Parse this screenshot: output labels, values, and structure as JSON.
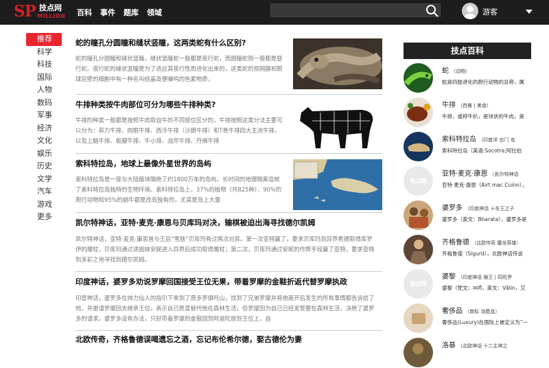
{
  "header": {
    "logo_sp": "SP",
    "logo_cn": "技点网",
    "logo_en": "MILLION",
    "nav": [
      "百科",
      "事件",
      "题库",
      "领域"
    ],
    "search_placeholder": "",
    "username": "游客"
  },
  "sidebar": {
    "items": [
      "推荐",
      "科学",
      "科技",
      "国际",
      "人物",
      "数码",
      "军事",
      "经济",
      "文化",
      "娱乐",
      "历史",
      "文学",
      "汽车",
      "游戏",
      "更多"
    ]
  },
  "articles": [
    {
      "title": "蛇的瞳孔分圆瞳和缝状竖瞳，这两类蛇有什么区别?",
      "summary": "蛇的瞳孔分圆瞳和缝状竖瞳，缝状竖瞳蛇一般都是夜行蛇，而圆瞳蛇则一般都是昼行蛇。夜行蛇的缝状竖瞳是为了适应其夜行性而进化出来的，这类蛇的视网膜和眼球后壁的细胞中有一种名叫结晶岛便曝鸣的色素物质，"
    },
    {
      "title": "牛排种类按牛肉部位可分为哪些牛排种类?",
      "summary": "牛排的种类一般都是按照牛肉取自牛的不同部位区分的，牛排按照这类分法主要可以分为：菲力牛排、肉眼牛排、西冷牛排（沙朗牛排）和T骨牛排四大主流牛排，以及上脑牛排、板腱牛排、牛小排、战斧牛排、丹佛牛排"
    },
    {
      "title": "索科特拉岛，地球上最像外星世界的岛屿",
      "summary": "索科特拉岛是一座与大陆版块隔绝了约1800万年的岛屿，长时间的地理隔离造就了索科特拉岛独特的生物环境。索科特拉岛上，37%的植物（共825种）、90%的爬行动物和95%的蜗牛都是改岛独有的，尤其是岛上大量"
    },
    {
      "title": "凯尔特神话，亚特·麦克·康恩与贝库玛对决，输棋被迫出海寻找德尔凯姆",
      "summary": "凯尔特神话，亚特·麦克·康恩曾与王后“雪肤”贝库玛有过两次对弈。第一次亚特赢了，要求贝库玛到异界希德取得库罗伊的魔杖，贝库玛通过诱姐妹安妮进入异界后成功取得魔杖；第二次，贝库玛通过安妮的作弊手段赢了亚特，要求亚特到多彩之地寻找到德尔凯姆。"
    },
    {
      "title": "印度神话，婆罗多劝说罗摩回国接受王位无果，带着罗摩的金鞋折返代替罗摩执政",
      "summary": "印度神话，婆罗多在持力仙人的指引下来到了质多罗俱吒山，找到了兄弟罗摩并将他离开后发生的所有事情都告诉给了他，并邀请罗摩回去继承王位，表示自己愿意替代他在森林生活，但罗摩因为自己已经发誓要在森林生活，决绝了婆罗多的请求。婆罗多没有办法，只好带着罗摩的金鞋回到阿逾陀放到王位上，自"
    },
    {
      "title": "北欧传奇，齐格鲁德误喝遗忘之酒，忘记布伦希尔德，娶古德伦为妻",
      "summary": ""
    }
  ],
  "right_panel": {
    "heading": "技点百科",
    "items": [
      {
        "name": "蛇",
        "tag": "（动物）",
        "desc": "蛇是四肢退化的爬行动物的总称，属",
        "img": "snake"
      },
      {
        "name": "牛排",
        "tag": "（西餐 | 美食）",
        "desc": "牛排，或称牛扒，是块状的牛肉，是",
        "img": "steak"
      },
      {
        "name": "索科特拉岛",
        "tag": "（印度洋 也门 岛",
        "desc": "索科特拉岛（英语:Socotra;阿拉伯",
        "img": "island"
      },
      {
        "name": "亚特·麦克·康恩",
        "tag": "（凯尔特神话",
        "desc": "亚特·麦克·康恩（Airt mac Cuinn），",
        "img": "placeholder"
      },
      {
        "name": "婆罗多",
        "tag": "（印度神话 十车王之子",
        "desc": "婆罗多（英文：Bharata），婆罗多是",
        "img": "bharata"
      },
      {
        "name": "齐格鲁德",
        "tag": "（北欧传奇 屠龙英雄）",
        "desc": "齐格鲁德（Sigurd），北欧神话传说",
        "img": "sigurd"
      },
      {
        "name": "婆黎",
        "tag": "（印度神话 猴王 | 四陀罗",
        "desc": "婆黎（梵文：वाली，英文：Vālin，又",
        "img": "placeholder"
      },
      {
        "name": "奢侈品",
        "tag": "（商标 消费品）",
        "desc": "奢侈品(Luxury)在国际上被定义为“一",
        "img": "luxury"
      },
      {
        "name": "洛基",
        "tag": "（北欧神话 十二主神之",
        "desc": "",
        "img": "loki"
      }
    ],
    "placeholder_text": "技点网"
  },
  "colors": {
    "topbar": "#1d1d1d",
    "accent": "#e8262f",
    "panel_header": "#222222"
  }
}
